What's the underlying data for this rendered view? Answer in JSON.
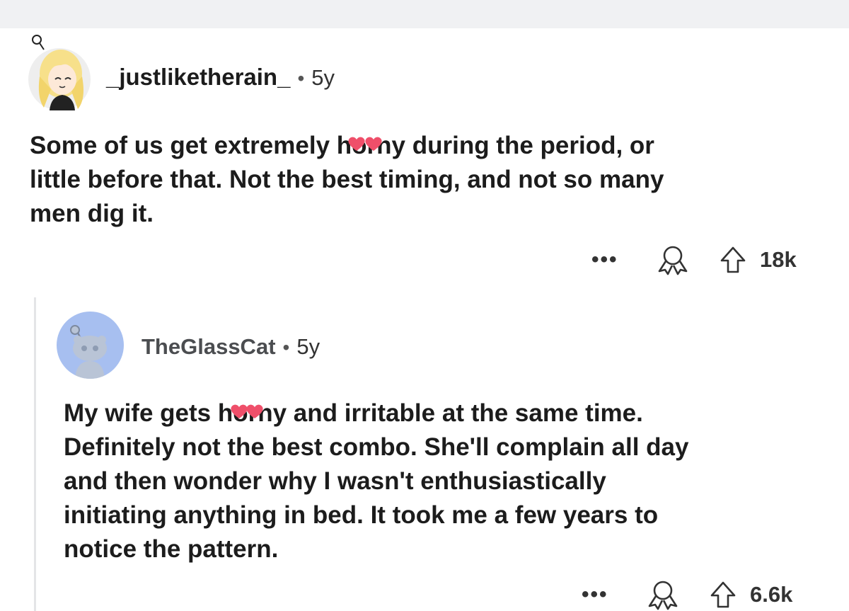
{
  "comments": [
    {
      "username": "_justliketherain_",
      "separator": "•",
      "age": "5y",
      "text_lines": [
        {
          "before": "Some of us get extremely h",
          "censored": "orn",
          "after": "y during the period, or"
        },
        {
          "text": "little before that. Not the best timing, and not so many"
        },
        {
          "text": "men dig it."
        }
      ],
      "actions": {
        "more": "•••",
        "score": "18k"
      }
    },
    {
      "username": "TheGlassCat",
      "separator": "•",
      "age": "5y",
      "text_lines": [
        {
          "before": "My wife gets h",
          "censored": "orn",
          "after": "y and irritable at the same time."
        },
        {
          "text": "Definitely not the best combo. She'll complain all day"
        },
        {
          "text": "and then wonder why I wasn't enthusiastically"
        },
        {
          "text": "initiating anything in bed. It took me a few years to"
        },
        {
          "text": "notice the pattern."
        }
      ],
      "actions": {
        "more": "•••",
        "score": "6.6k"
      }
    }
  ],
  "colors": {
    "censor_heart": "#ef4f6a",
    "reply_avatar_bg": "#a7bff0",
    "thread_line": "#e4e5e7"
  },
  "icons": [
    "more-options-icon",
    "award-icon",
    "upvote-arrow-icon",
    "heart-sticker-icon"
  ]
}
